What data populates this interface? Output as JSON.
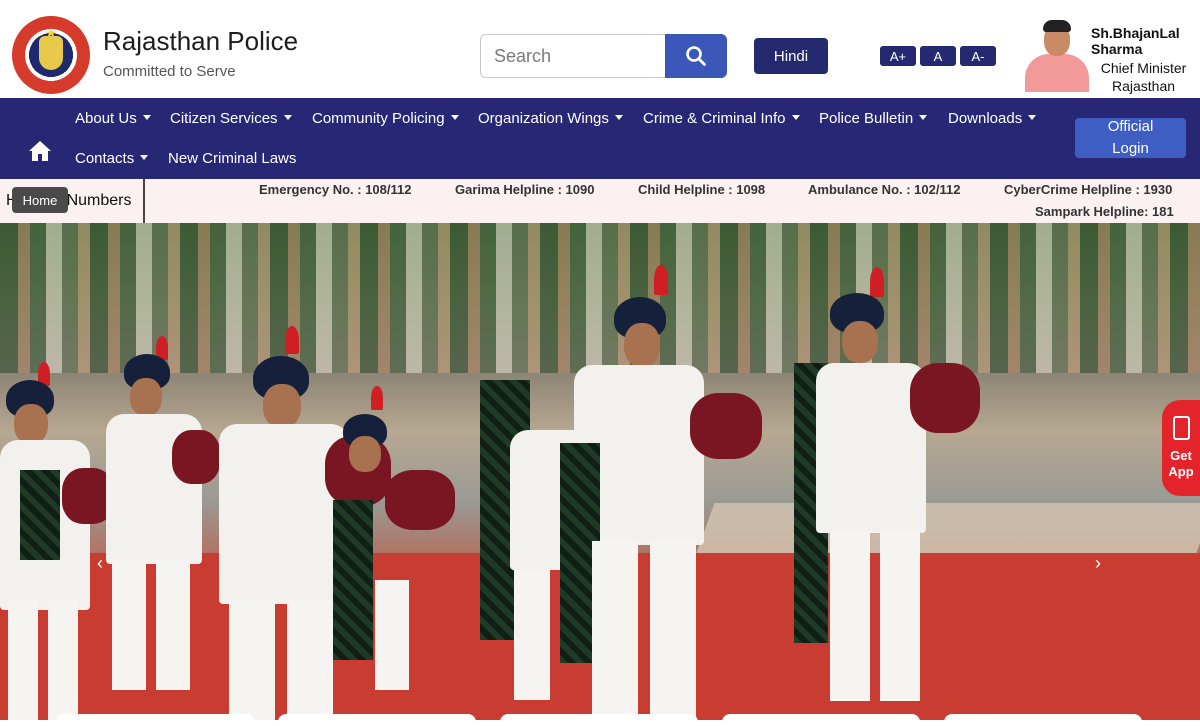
{
  "header": {
    "title": "Rajasthan Police",
    "tagline": "Committed to Serve",
    "search_placeholder": "Search",
    "language_button": "Hindi",
    "font_size": [
      "A+",
      "A",
      "A-"
    ],
    "cm": {
      "name": "Sh.BhajanLal Sharma",
      "title_line1": "Chief Minister",
      "title_line2": "Rajasthan"
    }
  },
  "nav": {
    "row1": [
      "About Us",
      "Citizen Services",
      "Community Policing",
      "Organization Wings",
      "Crime & Criminal Info",
      "Police Bulletin",
      "Downloads"
    ],
    "row2": [
      "Contacts",
      "New Criminal Laws"
    ],
    "login_line1": "Official",
    "login_line2": "Login"
  },
  "helplines": {
    "heading_prefix": "H",
    "heading_suffix": "Numbers",
    "tooltip": "Home",
    "items": [
      "Emergency No. : 108/112",
      "Garima Helpline : 1090",
      "Child Helpline : 1098",
      "Ambulance No. : 102/112",
      "CyberCrime Helpline : 1930",
      "Sampark Helpline: 181"
    ]
  },
  "hero": {
    "prev_arrow": "‹",
    "next_arrow": "›"
  },
  "get_app": {
    "line1": "Get",
    "line2": "App"
  },
  "icons": {
    "search": "search-icon",
    "home": "home-icon",
    "phone": "mobile-download-icon"
  },
  "colors": {
    "nav_bg": "#282776",
    "button_blue": "#3a57b8",
    "dark_button": "#25296f",
    "get_app": "#e4242b",
    "strip_bg": "#fbf1f1"
  }
}
